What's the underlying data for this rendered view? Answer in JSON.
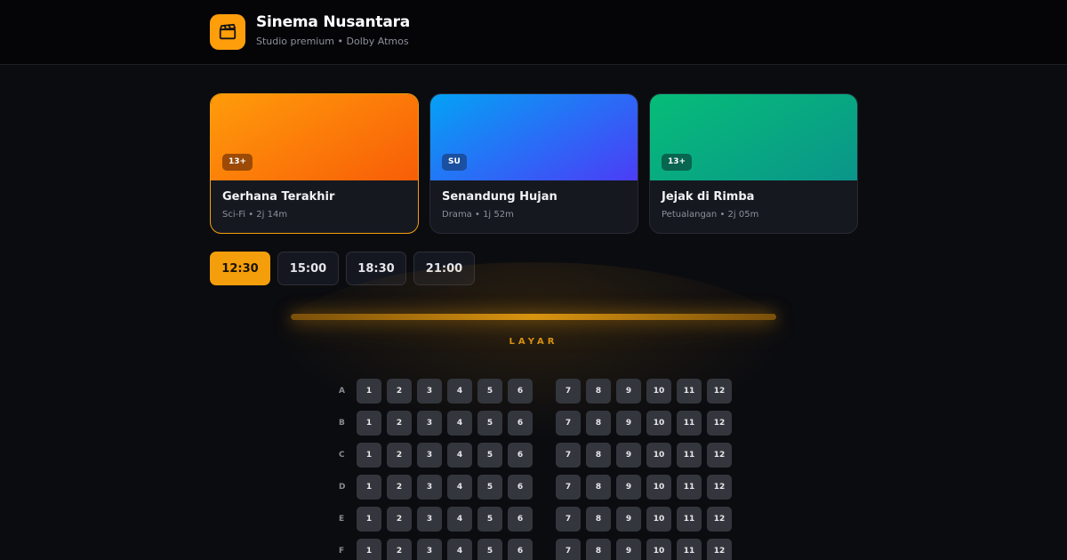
{
  "brand": {
    "name": "Sinema Nusantara",
    "subtitle": "Studio premium • Dolby Atmos",
    "icon": "clapperboard-icon",
    "accent": "#f59e0b"
  },
  "movies": [
    {
      "title": "Gerhana Terakhir",
      "meta": "Sci-Fi • 2j 14m",
      "rating": "13+",
      "selected": true,
      "gradient": [
        "#ff9a0a",
        "#f05a0a"
      ]
    },
    {
      "title": "Senandung Hujan",
      "meta": "Drama • 1j 52m",
      "rating": "SU",
      "selected": false,
      "gradient": [
        "#0aa0f5",
        "#4a3cf5"
      ]
    },
    {
      "title": "Jejak di Rimba",
      "meta": "Petualangan • 2j 05m",
      "rating": "13+",
      "selected": false,
      "gradient": [
        "#0cbc7a",
        "#0a9688"
      ]
    }
  ],
  "showtimes": [
    {
      "label": "12:30",
      "active": true
    },
    {
      "label": "15:00",
      "active": false
    },
    {
      "label": "18:30",
      "active": false
    },
    {
      "label": "21:00",
      "active": false
    }
  ],
  "screen": {
    "label": "LAYAR"
  },
  "seating": {
    "rows": [
      "A",
      "B",
      "C",
      "D",
      "E",
      "F"
    ],
    "left_block": [
      "1",
      "2",
      "3",
      "4",
      "5",
      "6"
    ],
    "right_block": [
      "7",
      "8",
      "9",
      "10",
      "11",
      "12"
    ]
  }
}
